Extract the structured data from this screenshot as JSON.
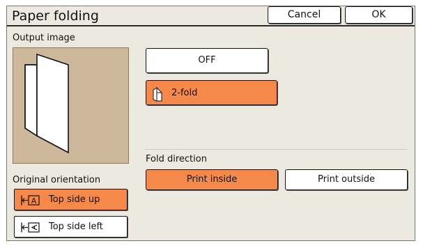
{
  "window": {
    "title": "Paper folding",
    "cancel_label": "Cancel",
    "ok_label": "OK"
  },
  "output_image": {
    "label": "Output image"
  },
  "fold_options": {
    "off_label": "OFF",
    "twofold_label": "2-fold",
    "selected": "2-fold"
  },
  "fold_direction": {
    "label": "Fold direction",
    "inside_label": "Print inside",
    "outside_label": "Print outside",
    "selected": "Print inside"
  },
  "orientation": {
    "label": "Original orientation",
    "top_up_label": "Top side up",
    "top_left_label": "Top side left",
    "selected": "Top side up"
  },
  "colors": {
    "selected": "#f5894a",
    "panel": "#ece9e1",
    "preview_bg": "#cdb89c"
  }
}
